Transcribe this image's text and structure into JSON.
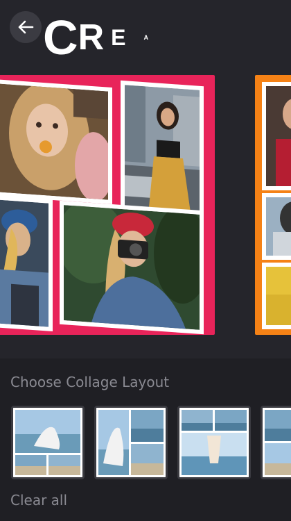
{
  "header": {
    "back_icon": "arrow-left-icon",
    "title_parts": [
      "C",
      "R",
      "E",
      "A"
    ]
  },
  "colors": {
    "background": "#25252b",
    "panel": "#1f1f24",
    "card_main_border": "#e8245a",
    "card_next_border": "#f58216",
    "muted_text": "#8a8a92"
  },
  "collage": {
    "main_card_photos": [
      "woman-with-flower-photo",
      "woman-city-street-photo",
      "woman-blue-jacket-photo",
      "woman-camera-red-beanie-photo"
    ],
    "next_card_photos": [
      "woman-red-top-photo",
      "partial-photo",
      "yellow-wall-photo"
    ]
  },
  "layouts": {
    "title": "Choose Collage Layout",
    "items": [
      "layout-1-top-two-bottom",
      "layout-2-left-tall-right-stack",
      "layout-3-top-two-large-bottom",
      "layout-4-partial"
    ]
  },
  "actions": {
    "clear_label": "Clear all"
  }
}
